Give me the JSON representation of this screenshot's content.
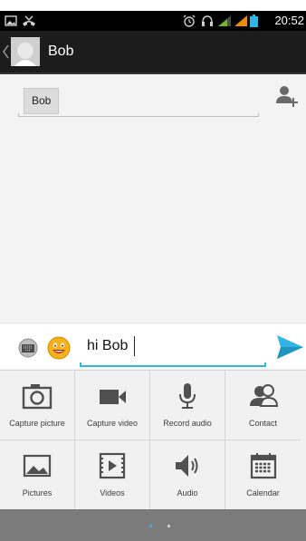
{
  "status_bar": {
    "time": "20:52",
    "icons": [
      "picture-icon",
      "missed-call-icon",
      "alarm-icon",
      "headset-icon",
      "signal-icon",
      "signal-icon",
      "battery-icon"
    ]
  },
  "action_bar": {
    "title": "Bob"
  },
  "recipients": {
    "chip_label": "Bob"
  },
  "compose": {
    "message_value": "hi Bob",
    "accent_color": "#31b5e5"
  },
  "attachments": [
    {
      "label": "Capture picture",
      "icon": "camera-icon"
    },
    {
      "label": "Capture video",
      "icon": "video-camera-icon"
    },
    {
      "label": "Record audio",
      "icon": "microphone-icon"
    },
    {
      "label": "Contact",
      "icon": "contact-icon"
    },
    {
      "label": "Pictures",
      "icon": "picture-icon"
    },
    {
      "label": "Videos",
      "icon": "video-file-icon"
    },
    {
      "label": "Audio",
      "icon": "speaker-icon"
    },
    {
      "label": "Calendar",
      "icon": "calendar-icon"
    }
  ],
  "pager": {
    "page_count": 2,
    "current_page": 1,
    "active_color": "#31b5e5"
  }
}
